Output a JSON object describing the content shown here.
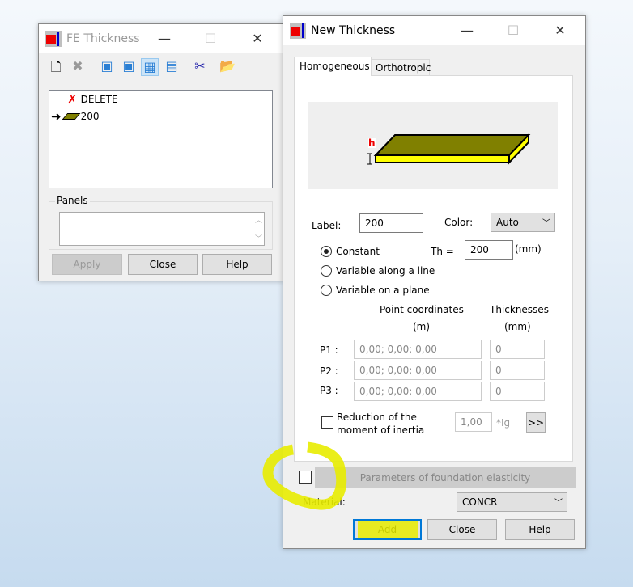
{
  "fe_window": {
    "title": "FE Thickness",
    "list": [
      {
        "label": "DELETE",
        "icon": "red-x-icon"
      },
      {
        "label": "200",
        "icon": "slab-icon",
        "current": true
      }
    ],
    "panels_label": "Panels",
    "apply": "Apply",
    "close": "Close",
    "help": "Help"
  },
  "nt_window": {
    "title": "New Thickness",
    "tabs": [
      "Homogeneous",
      "Orthotropic"
    ],
    "h_label": "h",
    "label_label": "Label:",
    "label_value": "200",
    "color_label": "Color:",
    "color_value": "Auto",
    "constant": "Constant",
    "th_label": "Th =",
    "th_value": "200",
    "th_unit": "(mm)",
    "variable_line": "Variable along a line",
    "variable_plane": "Variable on a plane",
    "point_coords": "Point coordinates",
    "m_unit": "(m)",
    "thicknesses": "Thicknesses",
    "mm_unit": "(mm)",
    "points": [
      {
        "label": "P1 :",
        "coords": "0,00; 0,00; 0,00",
        "th": "0"
      },
      {
        "label": "P2 :",
        "coords": "0,00; 0,00; 0,00",
        "th": "0"
      },
      {
        "label": "P3 :",
        "coords": "0,00; 0,00; 0,00",
        "th": "0"
      }
    ],
    "reduction_line1": "Reduction of the",
    "reduction_line2": "moment of inertia",
    "reduction_value": "1,00",
    "ig": "*Ig",
    "more": ">>",
    "foundation": "Parameters of foundation elasticity",
    "material_label": "Material:",
    "material_value": "CONCR",
    "add": "Add",
    "close": "Close",
    "help": "Help"
  },
  "colors": {
    "highlight": "#e8ec00",
    "accent": "#0078d7"
  }
}
